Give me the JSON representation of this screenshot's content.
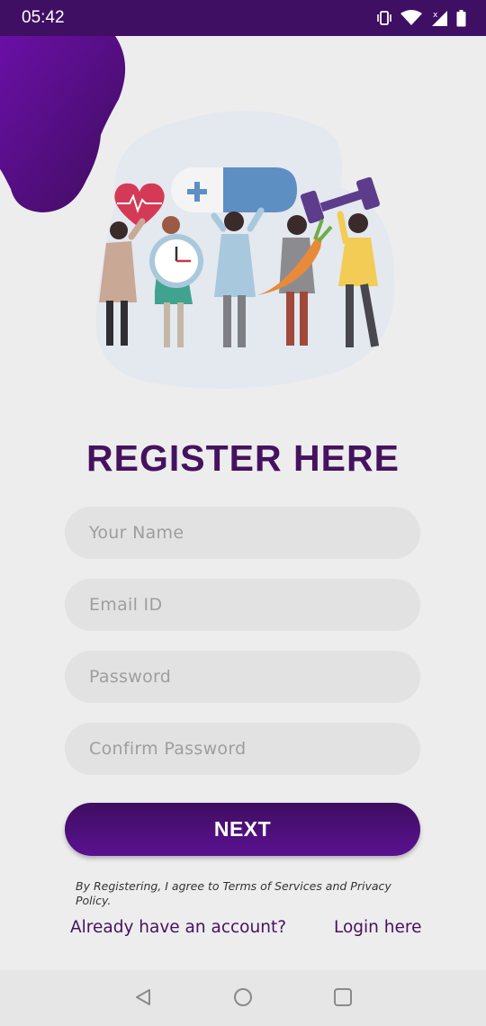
{
  "status_bar": {
    "time": "05:42",
    "icons": [
      "vibrate-icon",
      "wifi-icon",
      "signal-icon",
      "battery-icon"
    ]
  },
  "illustration": {
    "icons": [
      "heart-pulse-icon",
      "clock-icon",
      "pill-capsule-icon",
      "plus-icon",
      "carrot-icon",
      "dumbbell-icon"
    ]
  },
  "title": "REGISTER HERE",
  "form": {
    "name_placeholder": "Your Name",
    "email_placeholder": "Email ID",
    "password_placeholder": "Password",
    "confirm_password_placeholder": "Confirm Password",
    "next_label": "NEXT"
  },
  "terms_text": "By Registering, I agree to Terms of Services and Privacy Policy.",
  "footer": {
    "have_account_text": "Already have an account?",
    "login_link": "Login here"
  },
  "nav_bar": {
    "icons": [
      "back-icon",
      "home-icon",
      "recents-icon"
    ]
  },
  "colors": {
    "primary": "#45125f",
    "status_bar": "#3f0f63",
    "button_start": "#3f0e60",
    "button_end": "#5a1191",
    "field_background": "#e2e2e2",
    "page_background": "#ededed"
  }
}
